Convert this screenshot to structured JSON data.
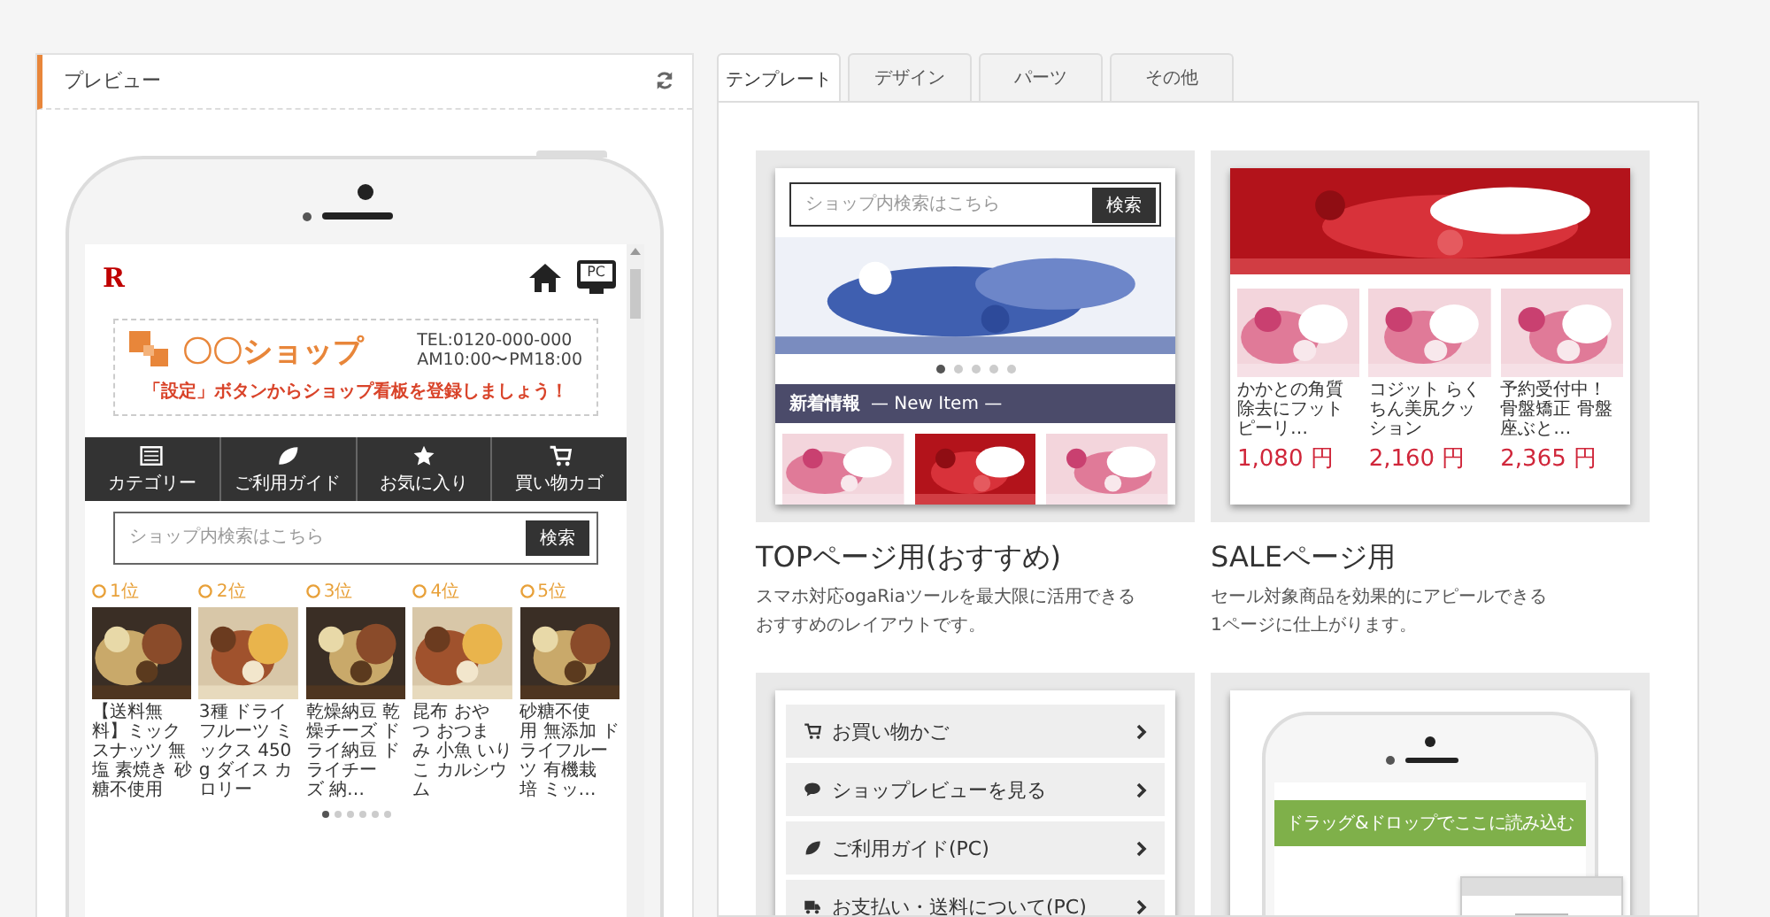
{
  "preview": {
    "title": "プレビュー",
    "phone": {
      "logo": "R",
      "pc_label": "PC",
      "shop_name": "〇〇ショップ",
      "tel": "TEL:0120-000-000",
      "hours": "AM10:00〜PM18:00",
      "notice": "「設定」ボタンからショップ看板を登録しましょう！",
      "nav": [
        {
          "label": "カテゴリー",
          "kind": "list"
        },
        {
          "label": "ご利用ガイド",
          "kind": "leaf"
        },
        {
          "label": "お気に入り",
          "kind": "star"
        },
        {
          "label": "買い物カゴ",
          "kind": "cart"
        }
      ],
      "search": {
        "placeholder": "ショップ内検索はこちら",
        "button": "検索"
      },
      "ranking": [
        {
          "rank": "1位",
          "name": "【送料無料】ミックスナッツ 無塩 素焼き 砂糖不使用"
        },
        {
          "rank": "2位",
          "name": "3種 ドライフルーツ ミックス 450g ダイス カロリー"
        },
        {
          "rank": "3位",
          "name": "乾燥納豆 乾燥チーズ ドライ納豆 ドライチーズ 納…"
        },
        {
          "rank": "4位",
          "name": "昆布 おやつ おつまみ 小魚 いりこ カルシウム"
        },
        {
          "rank": "5位",
          "name": "砂糖不使用 無添加 ドライフルーツ 有機栽培 ミッ…"
        }
      ],
      "dots": [
        {
          "selected": true
        },
        {
          "selected": false
        },
        {
          "selected": false
        },
        {
          "selected": false
        },
        {
          "selected": false
        },
        {
          "selected": false
        }
      ]
    }
  },
  "tabs": [
    {
      "label": "テンプレート",
      "selected": true
    },
    {
      "label": "デザイン",
      "selected": false
    },
    {
      "label": "パーツ",
      "selected": false
    },
    {
      "label": "その他",
      "selected": false
    }
  ],
  "templates": [
    {
      "kind": "top",
      "title": "TOPページ用(おすすめ)",
      "description": [
        "スマホ対応ogaRiaツールを最大限に活用できる",
        "おすすめのレイアウトです。"
      ],
      "preview": {
        "search_placeholder": "ショップ内検索はこちら",
        "search_button": "検索",
        "dots": [
          {
            "selected": true
          },
          {
            "selected": false
          },
          {
            "selected": false
          },
          {
            "selected": false
          },
          {
            "selected": false
          }
        ],
        "news_title": "新着情報",
        "news_sub": "— New Item —"
      }
    },
    {
      "kind": "sale",
      "title": "SALEページ用",
      "description": [
        "セール対象商品を効果的にアピールできる",
        "1ページに仕上がります。"
      ],
      "preview": {
        "products": [
          {
            "name": "かかとの角質除去にフットピーリ…",
            "price": "1,080 円"
          },
          {
            "name": "コジット らくちん美尻クッション",
            "price": "2,160 円"
          },
          {
            "name": "予約受付中！骨盤矯正 骨盤座ぶと…",
            "price": "2,365 円"
          }
        ]
      }
    },
    {
      "kind": "menu",
      "preview": {
        "items": [
          {
            "label": "お買い物かご",
            "kind": "cart"
          },
          {
            "label": "ショップレビューを見る",
            "kind": "chat"
          },
          {
            "label": "ご利用ガイド(PC)",
            "kind": "leaf"
          },
          {
            "label": "お支払い・送料について(PC)",
            "kind": "truck"
          }
        ]
      }
    },
    {
      "kind": "dragdrop",
      "preview": {
        "drop_label": "ドラッグ&ドロップでここに読み込む"
      }
    }
  ]
}
